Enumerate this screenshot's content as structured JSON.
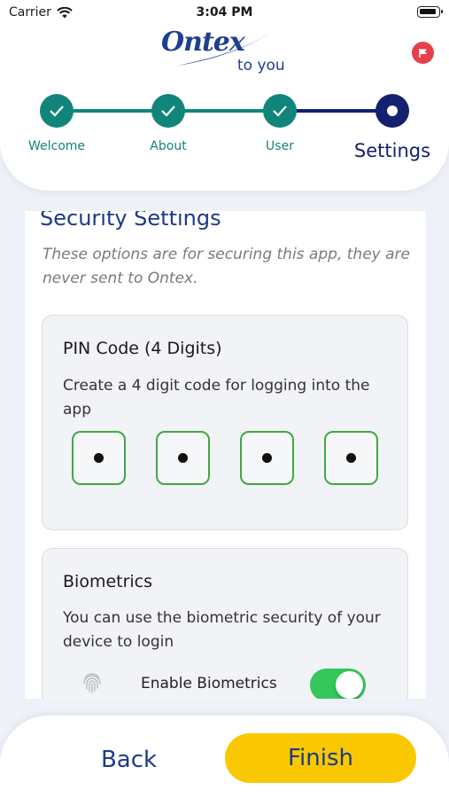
{
  "status_bar": {
    "carrier": "Carrier",
    "time": "3:04 PM"
  },
  "brand": {
    "name": "Ontex",
    "tagline": "to you"
  },
  "colors": {
    "brand_blue": "#1c3a86",
    "step_done": "#12857a",
    "step_current": "#13216f",
    "pin_border": "#41a844",
    "toggle_on": "#35c759",
    "finish_button": "#f9c800",
    "flag_button": "#e8404a"
  },
  "stepper": {
    "steps": [
      {
        "label": "Welcome",
        "state": "done",
        "icon": "checkmark-icon"
      },
      {
        "label": "About",
        "state": "done",
        "icon": "checkmark-icon"
      },
      {
        "label": "User",
        "state": "done",
        "icon": "checkmark-icon"
      },
      {
        "label": "Settings",
        "state": "current"
      }
    ]
  },
  "security": {
    "title": "Security Settings",
    "description": "These options are for securing this app, they are never sent to Ontex."
  },
  "pin_card": {
    "title": "PIN Code (4 Digits)",
    "text": "Create a 4 digit code for logging into the app",
    "digits_filled": 4
  },
  "biometrics_card": {
    "title": "Biometrics",
    "text": "You can use the biometric security of your device to login",
    "toggle_label": "Enable Biometrics",
    "toggle_on": true,
    "icon": "fingerprint-icon"
  },
  "footer": {
    "back_label": "Back",
    "finish_label": "Finish"
  }
}
